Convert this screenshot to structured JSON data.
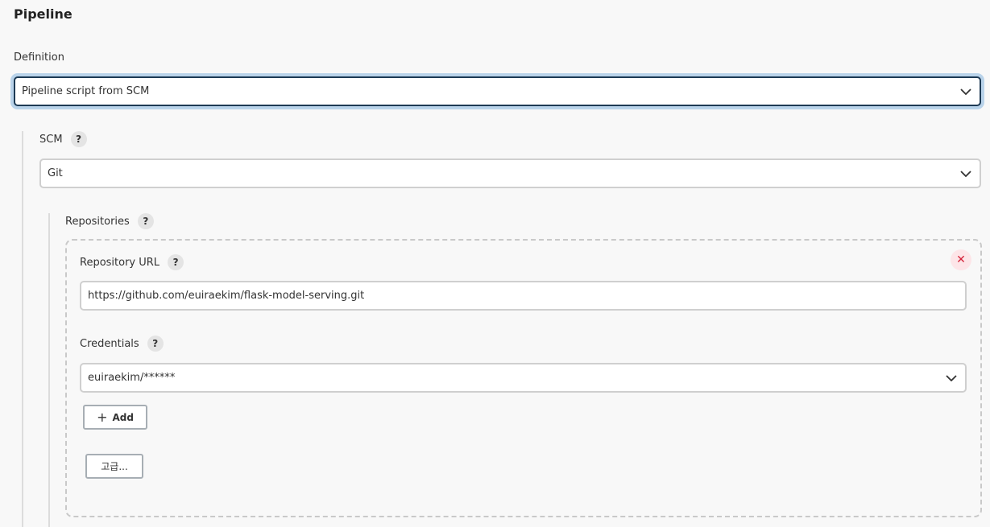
{
  "pipeline": {
    "title": "Pipeline",
    "definition_label": "Definition",
    "definition_value": "Pipeline script from SCM"
  },
  "scm": {
    "label": "SCM",
    "help": "?",
    "value": "Git"
  },
  "repositories": {
    "label": "Repositories",
    "help": "?",
    "remove_symbol": "✕",
    "repo_url_label": "Repository URL",
    "repo_url_help": "?",
    "repo_url_value": "https://github.com/euiraekim/flask-model-serving.git",
    "credentials_label": "Credentials",
    "credentials_help": "?",
    "credentials_value": "euiraekim/******",
    "add_symbol": "+",
    "add_label": "Add",
    "advanced_label": "고급..."
  },
  "icons": {
    "dropdown": "chevron-down-icon",
    "help": "question-mark-icon",
    "remove": "close-icon",
    "add": "plus-icon"
  },
  "colors": {
    "focus_border": "#1d3a54",
    "focus_ring": "#b9d3ea",
    "remove_bg": "#fde5e8",
    "remove_fg": "#d5243b"
  }
}
